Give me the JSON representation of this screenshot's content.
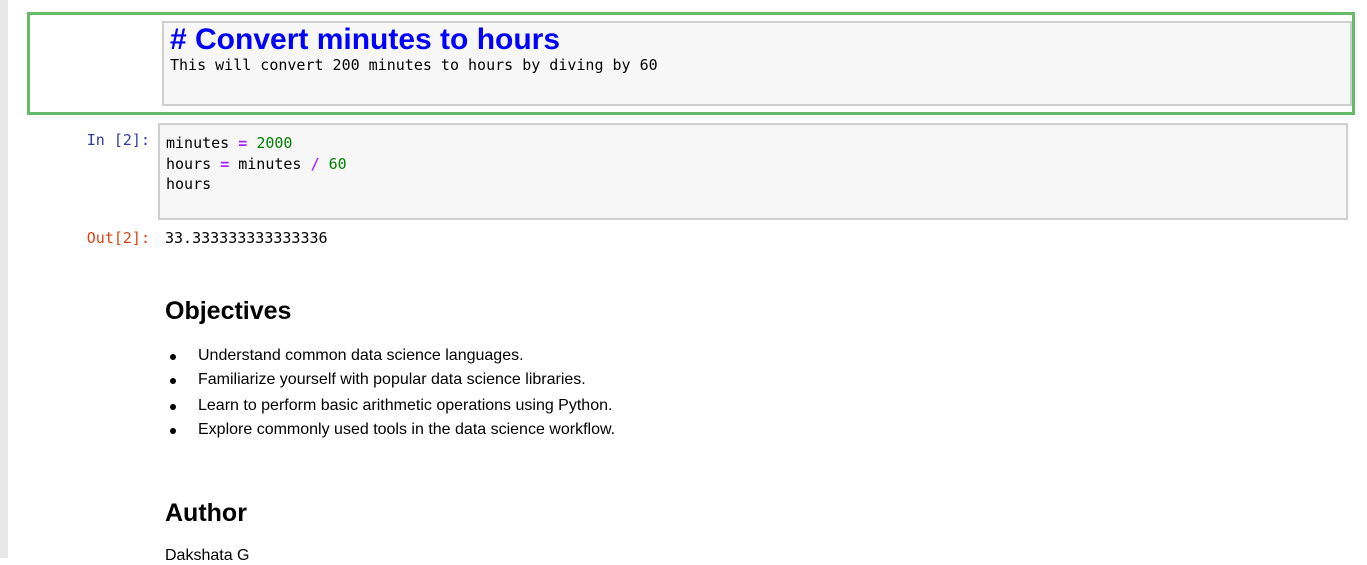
{
  "markdown_cell": {
    "heading": "# Convert minutes to hours",
    "body": "This will convert 200 minutes to hours by diving by 60"
  },
  "code_cell": {
    "in_prompt": "In [2]:",
    "lines": [
      {
        "var": "minutes",
        "op": "=",
        "value": "2000"
      },
      {
        "var": "hours",
        "op": "=",
        "rhs_var": "minutes",
        "op2": "/",
        "value": "60"
      },
      {
        "var": "hours"
      }
    ],
    "out_prompt": "Out[2]:",
    "output": "33.333333333333336"
  },
  "rendered": {
    "objectives_heading": "Objectives",
    "objectives": [
      "Understand common data science languages.",
      "Familiarize yourself with popular data science libraries.",
      "Learn to perform basic arithmetic operations using Python.",
      "Explore commonly used tools in the data science workflow."
    ],
    "author_heading": "Author",
    "author_name": "Dakshata G"
  },
  "colors": {
    "selected_border": "#66bb6a",
    "heading_markup": "#0000ff",
    "in_prompt": "#303f9f",
    "out_prompt": "#d84315",
    "operator": "#aa22ff",
    "number": "#008000"
  }
}
